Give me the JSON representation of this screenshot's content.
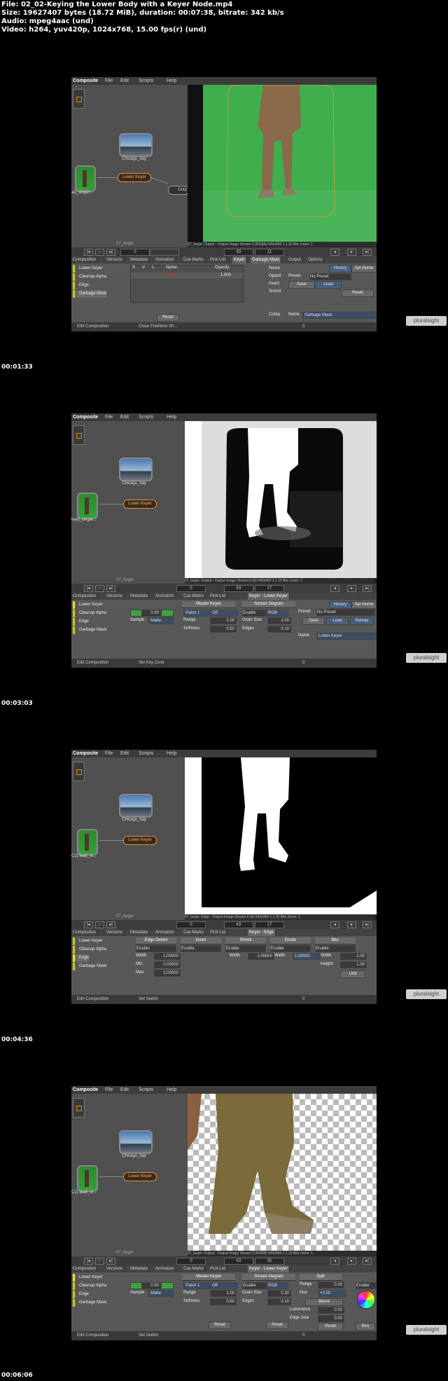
{
  "header": {
    "file": "File: 02_02-Keying the Lower Body with a Keyer Node.mp4",
    "size": "Size: 19627407 bytes (18.72 MiB), duration: 00:07:38, bitrate: 342 kb/s",
    "audio": "Audio: mpeg4aac (und)",
    "video": "Video: h264, yuv420p, 1024x768, 15.00 fps(r) (und)"
  },
  "brand": "pluralsight",
  "timestamps": [
    "00:01:33",
    "00:03:03",
    "00:04:36",
    "00:06:06"
  ],
  "frames": [
    {
      "menu": [
        "Composite",
        "File",
        "Edit",
        "Scripts",
        "Help"
      ],
      "nodes": {
        "bg": "Chicago_bay",
        "plate": "ad_singer...",
        "keyer": "Lower Keyer",
        "out": "Outp",
        "comp": "07_begin"
      },
      "viewer_status": "07_begin: Output - Output Image  Stream 0 (RGBA)  540x960  1:1  32 Bits  Zoom: 1",
      "time": {
        "start": "0",
        "cur": "63",
        "end": "11"
      },
      "tabs": [
        "Composition",
        "Versions",
        "Metadata",
        "Animation",
        "Cue Marks",
        "Pick List",
        "Keyer",
        "Garbage Mask",
        "Output",
        "Options"
      ],
      "list": [
        "Lower Keyer",
        "Cleanup Alpha",
        "Edge",
        "Garbage Mask"
      ],
      "table_headers": [
        "S",
        "V",
        "L",
        "Name",
        "Opacity"
      ],
      "row": {
        "name": "Bezier",
        "opacity": "1.000"
      },
      "right": {
        "name_lbl": "Name",
        "opacit_lbl": "Opacit",
        "preset_lbl": "Preset",
        "preset_val": "No Preset",
        "invert_lbl": "Invert",
        "save": "Save",
        "load": "Load",
        "smooth_lbl": "Smoot",
        "reset": "Reset",
        "comp_lbl": "Comp",
        "name2": "Name",
        "name2_val": "Garbage Mask",
        "history": "History",
        "sethome": "Set Home",
        "reset_btn": "Reset"
      },
      "status": {
        "left": "Edit Composition",
        "mid": "Close Freeform Sh...",
        "zero": "0"
      }
    },
    {
      "menu": [
        "Composite",
        "File",
        "Edit",
        "Scripts",
        "Help"
      ],
      "nodes": {
        "bg": "Chicago_bay",
        "plate": "lead_singer...",
        "keyer": "Lower Keyer",
        "comp": "07_begin"
      },
      "viewer_status": "07_begin: Output - Output Image  Stream 0 (A)  540x960  1:1  32 Bits  Zoom: 1",
      "time": {
        "start": "0",
        "cur": "63",
        "end": "17"
      },
      "tabs": [
        "Composition",
        "Versions",
        "Metadata",
        "Animation",
        "Cue Marks",
        "Pick List",
        "Keyer - Lower Keyer"
      ],
      "list": [
        "Lower Keyer",
        "Cleanup Alpha",
        "Edge",
        "Garbage Mask"
      ],
      "mk": {
        "title": "Master Keyer",
        "v": "0.50",
        "patch": "Patch 1",
        "off": "Off",
        "sample": "Sample",
        "matte": "Matte",
        "range": "Range",
        "range_v": "1.00",
        "soft": "Softness",
        "soft_v": "0.50"
      },
      "sd": {
        "title": "Screen Degrain",
        "enable": "Enable",
        "rgb": "RGB",
        "grain": "Grain Size",
        "grain_v": "1.00",
        "edges": "Edges",
        "edges_v": "0.10"
      },
      "right": {
        "preset_lbl": "Preset",
        "preset_val": "No Preset",
        "save": "Save",
        "load": "Load",
        "reload": "Reload",
        "name": "Name",
        "name_val": "Lower Keyer",
        "history": "History",
        "sethome": "Set Home"
      },
      "status": {
        "left": "Edit Composition",
        "mid": "Set Key Color",
        "zero": "0"
      }
    },
    {
      "menu": [
        "Composite",
        "File",
        "Edit",
        "Scripts",
        "Help"
      ],
      "nodes": {
        "bg": "Chicago_bay",
        "plate": "C1) lead_si...",
        "keyer": "Lower Keyer",
        "comp": "07_begin"
      },
      "viewer_status": "07_begin: Edge - Output Image  Stream 0 (A)  540x960  1:1  32 Bits  Zoom: 1",
      "time": {
        "start": "0",
        "cur": "63",
        "end": "17"
      },
      "tabs": [
        "Composition",
        "Versions",
        "Metadata",
        "Animation",
        "Cue Marks",
        "Pick List",
        "Keyer - Edge"
      ],
      "list": [
        "Lower Keyer",
        "Cleanup Alpha",
        "Edge",
        "Garbage Mask"
      ],
      "groups": [
        "Edge Detect",
        "Invert",
        "Shrink",
        "Erode",
        "Blur"
      ],
      "enable": "Enable",
      "width_lbl": "Width",
      "width_v": "1.00000",
      "min_lbl": "Min",
      "min_v": "0.00000",
      "max_lbl": "Max",
      "max_v": "1.00000",
      "shrink_w": "1.00000",
      "erode_w": "1.50000",
      "blur": {
        "width": "Width",
        "width_v": "1.00",
        "height": "Height",
        "height_v": "1.00",
        "link": "Link"
      },
      "status": {
        "left": "Edit Composition",
        "mid": "Set Switch",
        "zero": "0"
      }
    },
    {
      "menu": [
        "Composite",
        "File",
        "Edit",
        "Scripts",
        "Help"
      ],
      "nodes": {
        "bg": "Chicago_bay",
        "plate": "C1) lead_si...",
        "keyer": "Lower Keyer",
        "comp": "07_begin"
      },
      "viewer_status": "07_begin: Output - Output Image  Stream 0 (RGBA)  540x960  1:1  32 Bits  Zoom: 1",
      "time": {
        "start": "0",
        "cur": "63",
        "end": "35"
      },
      "tabs": [
        "Composition",
        "Versions",
        "Metadata",
        "Animation",
        "Cue Marks",
        "Pick List",
        "Keyer - Lower Keyer"
      ],
      "list": [
        "Lower Keyer",
        "Cleanup Alpha",
        "Edge",
        "Garbage Mask"
      ],
      "mk": {
        "title": "Master Keyer",
        "v": "0.50",
        "patch": "Patch 1",
        "off": "Off",
        "sample": "Sample",
        "matte": "Matte",
        "range": "Range",
        "range_v": "1.00",
        "soft": "Softness",
        "soft_v": "0.50",
        "reset": "Reset"
      },
      "sd": {
        "title": "Screen Degrain",
        "enable": "Enable",
        "rgb": "RGB",
        "grain": "Grain Size",
        "grain_v": "0.30",
        "edges": "Edges",
        "edges_v": "0.10",
        "reset": "Reset"
      },
      "spill": {
        "title": "Spill",
        "range": "Range",
        "range_v": "0.00",
        "hue": "Hue",
        "hue_v": "+0.50",
        "blend": "Blend",
        "lum": "Luminance",
        "lum_v": "0.00",
        "edge": "Edge Size",
        "edge_v": "0.00",
        "enable": "Enable",
        "reset": "Reset",
        "reset2": "Res"
      },
      "status": {
        "left": "Edit Composition",
        "mid": "Set Switch",
        "zero": "0"
      }
    }
  ]
}
